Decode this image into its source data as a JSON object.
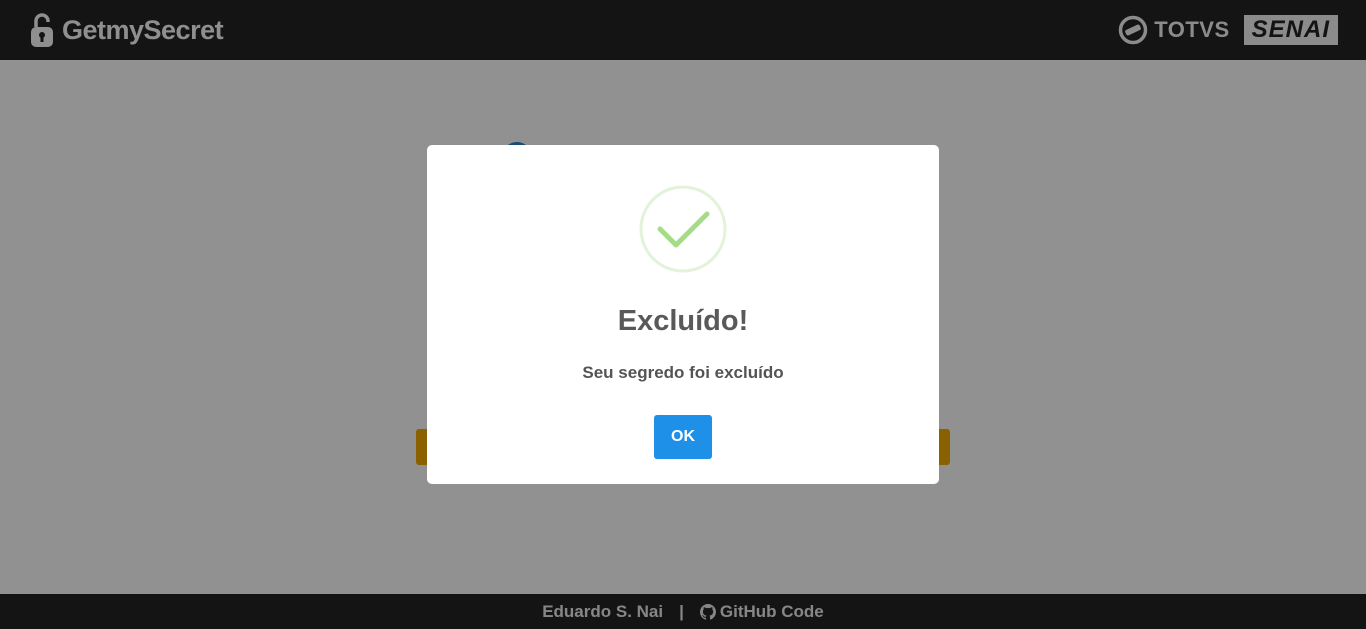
{
  "header": {
    "brand_name": "GetmySecret",
    "partner_1": "TOTVS",
    "partner_2": "SENAI"
  },
  "modal": {
    "icon": "success-check-icon",
    "title": "Excluído!",
    "message": "Seu segredo foi excluído",
    "ok_label": "OK"
  },
  "footer": {
    "author": "Eduardo S. Nai",
    "separator": "|",
    "github_label": "GitHub Code"
  },
  "colors": {
    "header_bg": "#222222",
    "accent_button": "#1e90e8",
    "success_green": "#a5dc86",
    "background_bar": "#e6a100"
  }
}
